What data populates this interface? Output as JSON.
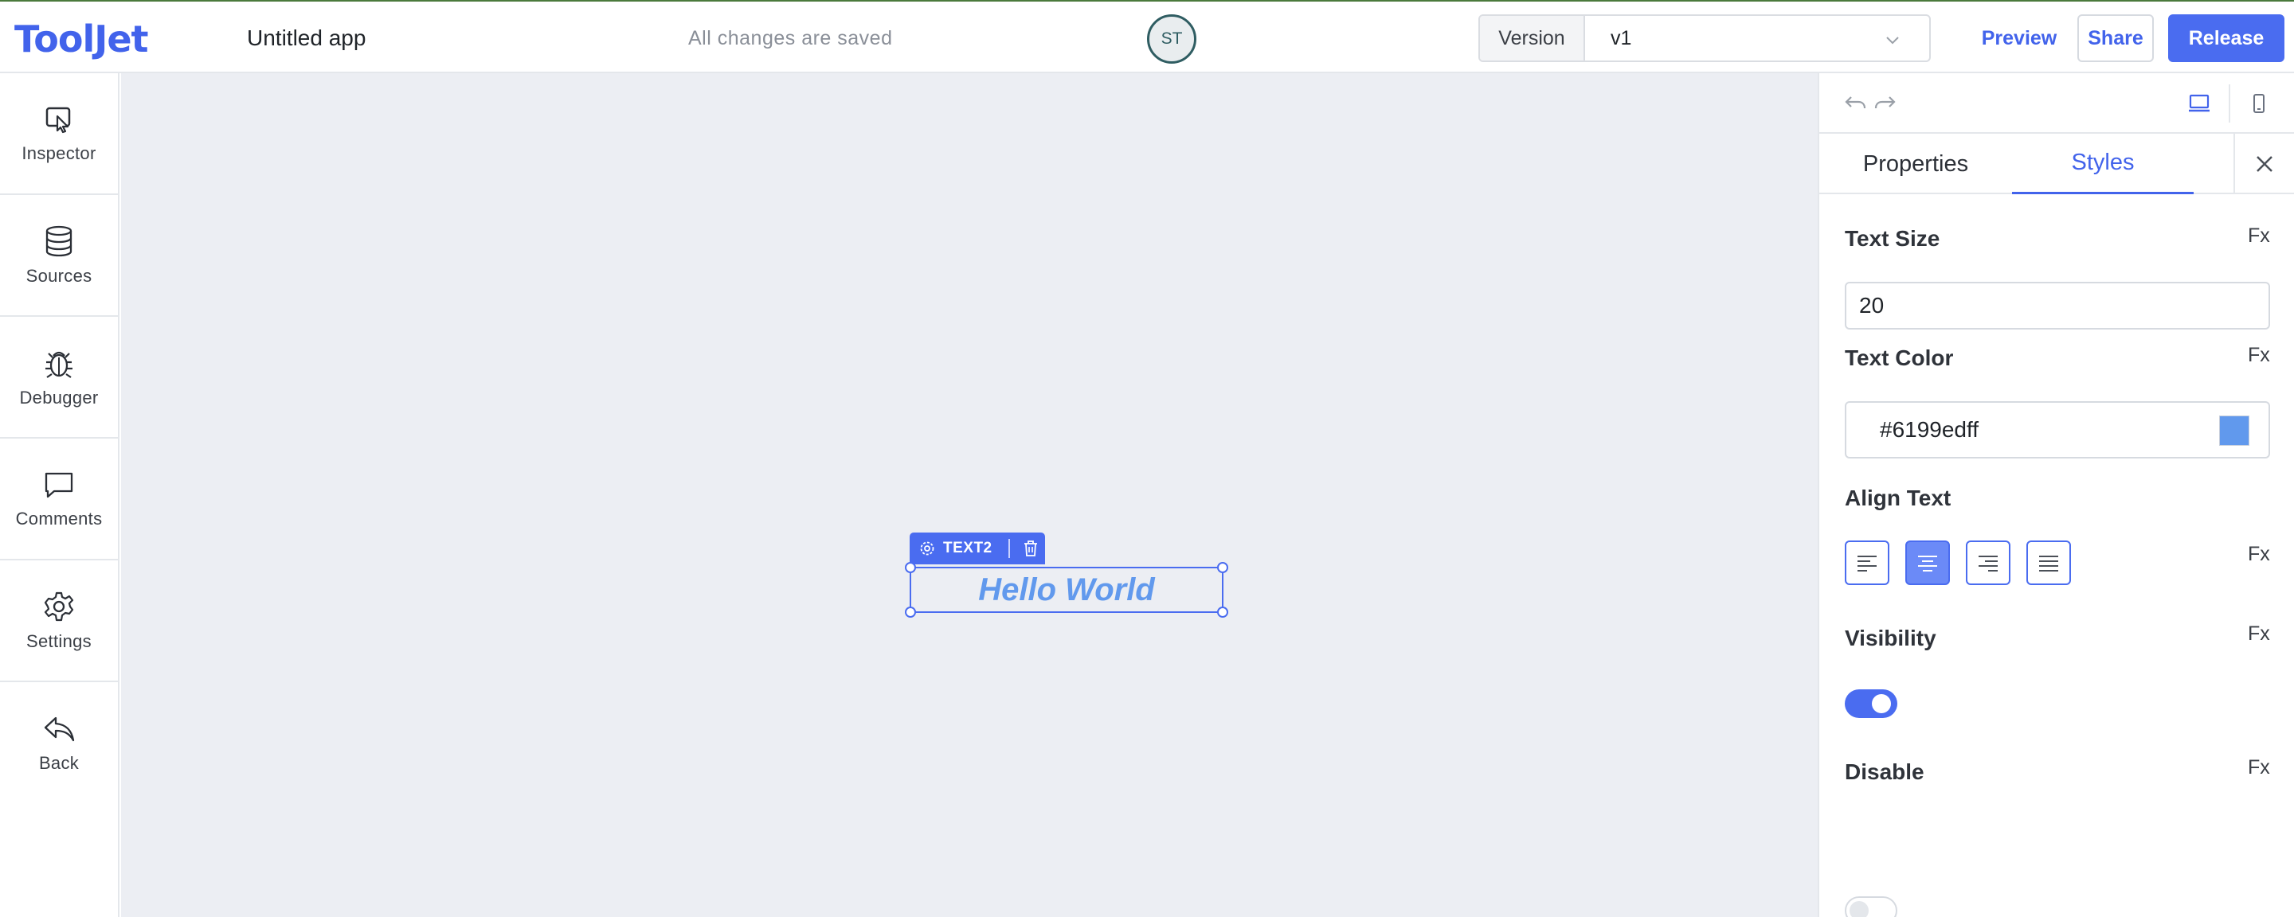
{
  "header": {
    "logo": "ToolJet",
    "app_title": "Untitled app",
    "save_status": "All changes are saved",
    "avatar_initials": "ST",
    "version_label": "Version",
    "version_value": "v1",
    "preview_label": "Preview",
    "share_label": "Share",
    "release_label": "Release"
  },
  "sidebar": {
    "items": [
      {
        "label": "Inspector",
        "icon": "inspector-icon"
      },
      {
        "label": "Sources",
        "icon": "database-icon"
      },
      {
        "label": "Debugger",
        "icon": "bug-icon"
      },
      {
        "label": "Comments",
        "icon": "comment-icon"
      },
      {
        "label": "Settings",
        "icon": "gear-icon"
      },
      {
        "label": "Back",
        "icon": "back-arrow-icon"
      }
    ]
  },
  "canvas": {
    "widget_name": "TEXT2",
    "widget_text": "Hello World"
  },
  "panel": {
    "tabs": [
      "Properties",
      "Styles"
    ],
    "active_tab": "Styles",
    "fx_label": "Fx",
    "text_size": {
      "label": "Text Size",
      "value": "20"
    },
    "text_color": {
      "label": "Text Color",
      "value": "#6199edff",
      "swatch": "#6199ed"
    },
    "align_text": {
      "label": "Align Text",
      "options": [
        "left",
        "center",
        "right",
        "justify"
      ],
      "selected": "center"
    },
    "visibility": {
      "label": "Visibility",
      "enabled": true
    },
    "disable": {
      "label": "Disable",
      "enabled": false
    }
  },
  "colors": {
    "accent": "#4263eb",
    "canvas_bg": "#eceef3",
    "text_color": "#6199ed"
  }
}
